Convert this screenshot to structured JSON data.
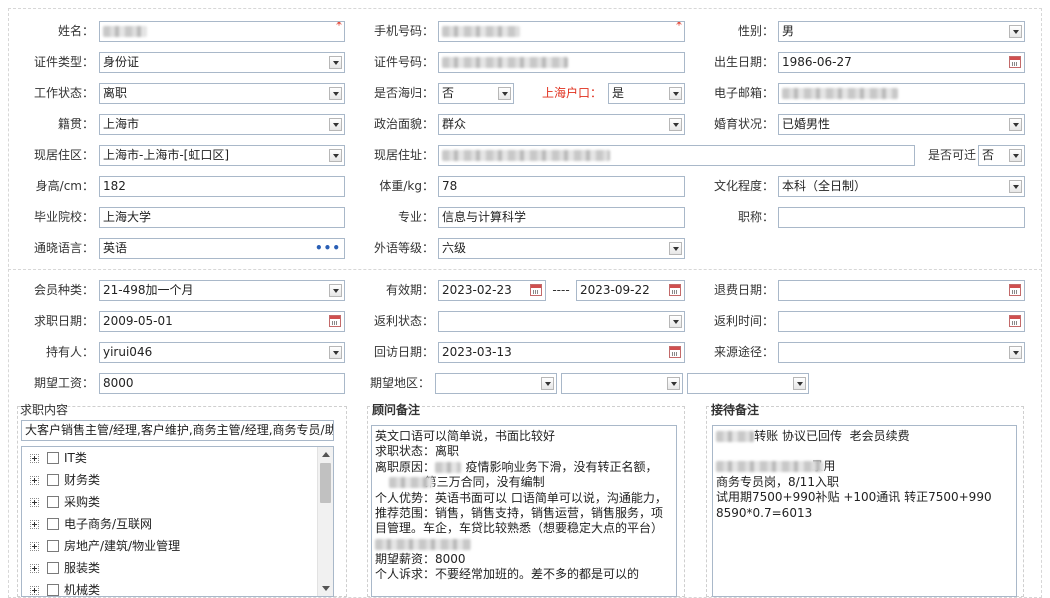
{
  "personal": {
    "name": {
      "label": "姓名：",
      "value": ""
    },
    "phone": {
      "label": "手机号码：",
      "value": ""
    },
    "gender": {
      "label": "性别：",
      "value": "男"
    },
    "id_type": {
      "label": "证件类型：",
      "value": "身份证"
    },
    "id_number": {
      "label": "证件号码：",
      "value": ""
    },
    "birth_date": {
      "label": "出生日期：",
      "value": "1986-06-27"
    },
    "work_status": {
      "label": "工作状态：",
      "value": "离职"
    },
    "overseas_return": {
      "label": "是否海归：",
      "value": "否"
    },
    "shanghai_hukou": {
      "label": "上海户口：",
      "value": "是"
    },
    "email": {
      "label": "电子邮箱：",
      "value": ""
    },
    "native_place": {
      "label": "籍贯：",
      "value": "上海市"
    },
    "political_status": {
      "label": "政治面貌：",
      "value": "群众"
    },
    "marital_status": {
      "label": "婚育状况：",
      "value": "已婚男性"
    },
    "current_area": {
      "label": "现居住区：",
      "value": "上海市-上海市-[虹口区]"
    },
    "current_address": {
      "label": "现居住址：",
      "value": ""
    },
    "relocate": {
      "label": "是否可迁",
      "value": "否"
    },
    "height": {
      "label": "身高/cm：",
      "value": "182"
    },
    "weight": {
      "label": "体重/kg：",
      "value": "78"
    },
    "education": {
      "label": "文化程度：",
      "value": "本科（全日制）"
    },
    "school": {
      "label": "毕业院校：",
      "value": "上海大学"
    },
    "major": {
      "label": "专业：",
      "value": "信息与计算科学"
    },
    "title": {
      "label": "职称：",
      "value": ""
    },
    "language": {
      "label": "通晓语言：",
      "value": "英语",
      "more": "•••"
    },
    "language_level": {
      "label": "外语等级：",
      "value": "六级"
    }
  },
  "membership": {
    "member_type": {
      "label": "会员种类：",
      "value": "21-498加一个月"
    },
    "validity": {
      "label": "有效期：",
      "start": "2023-02-23",
      "sep": "----",
      "end": "2023-09-22"
    },
    "refund_date": {
      "label": "退费日期：",
      "value": ""
    },
    "job_search_date": {
      "label": "求职日期：",
      "value": "2009-05-01"
    },
    "rebate_status": {
      "label": "返利状态：",
      "value": ""
    },
    "rebate_time": {
      "label": "返利时间：",
      "value": ""
    },
    "holder": {
      "label": "持有人：",
      "value": "yirui046"
    },
    "visit_date": {
      "label": "回访日期：",
      "value": "2023-03-13"
    },
    "source": {
      "label": "来源途径：",
      "value": ""
    },
    "expected_salary": {
      "label": "期望工资：",
      "value": "8000"
    },
    "expected_region": {
      "label": "期望地区：",
      "values": [
        "",
        "",
        ""
      ]
    }
  },
  "job_content": {
    "title": "求职内容",
    "selected": "大客户销售主管/经理,客户维护,商务主管/经理,商务专员/助",
    "categories": [
      "IT类",
      "财务类",
      "采购类",
      "电子商务/互联网",
      "房地产/建筑/物业管理",
      "服装类",
      "机械类"
    ]
  },
  "advisor_notes": {
    "title": "顾问备注",
    "lines": [
      "英文口语可以简单说，书面比较好",
      "求职状态：离职",
      "离职原因：        疫情影响业务下滑，没有转正名额，",
      "             第三万合同，没有编制",
      "个人优势：英语书面可以 口语简单可以说，沟通能力，",
      "推荐范围：销售，销售支持，销售运营，销售服务，项",
      "目管理。车企，车贷比较熟悉（想要稳定大点的平台）",
      "",
      "期望薪资：8000",
      "个人诉求：不要经常加班的。差不多的都是可以的"
    ]
  },
  "reception_notes": {
    "title": "接待备注",
    "lines": [
      "          转账 协议已回传  老会员续费",
      "",
      "                         录用",
      "商务专员岗，8/11入职",
      "试用期7500+990补贴 +100通讯 转正7500+990",
      "8590*0.7=6013"
    ]
  }
}
